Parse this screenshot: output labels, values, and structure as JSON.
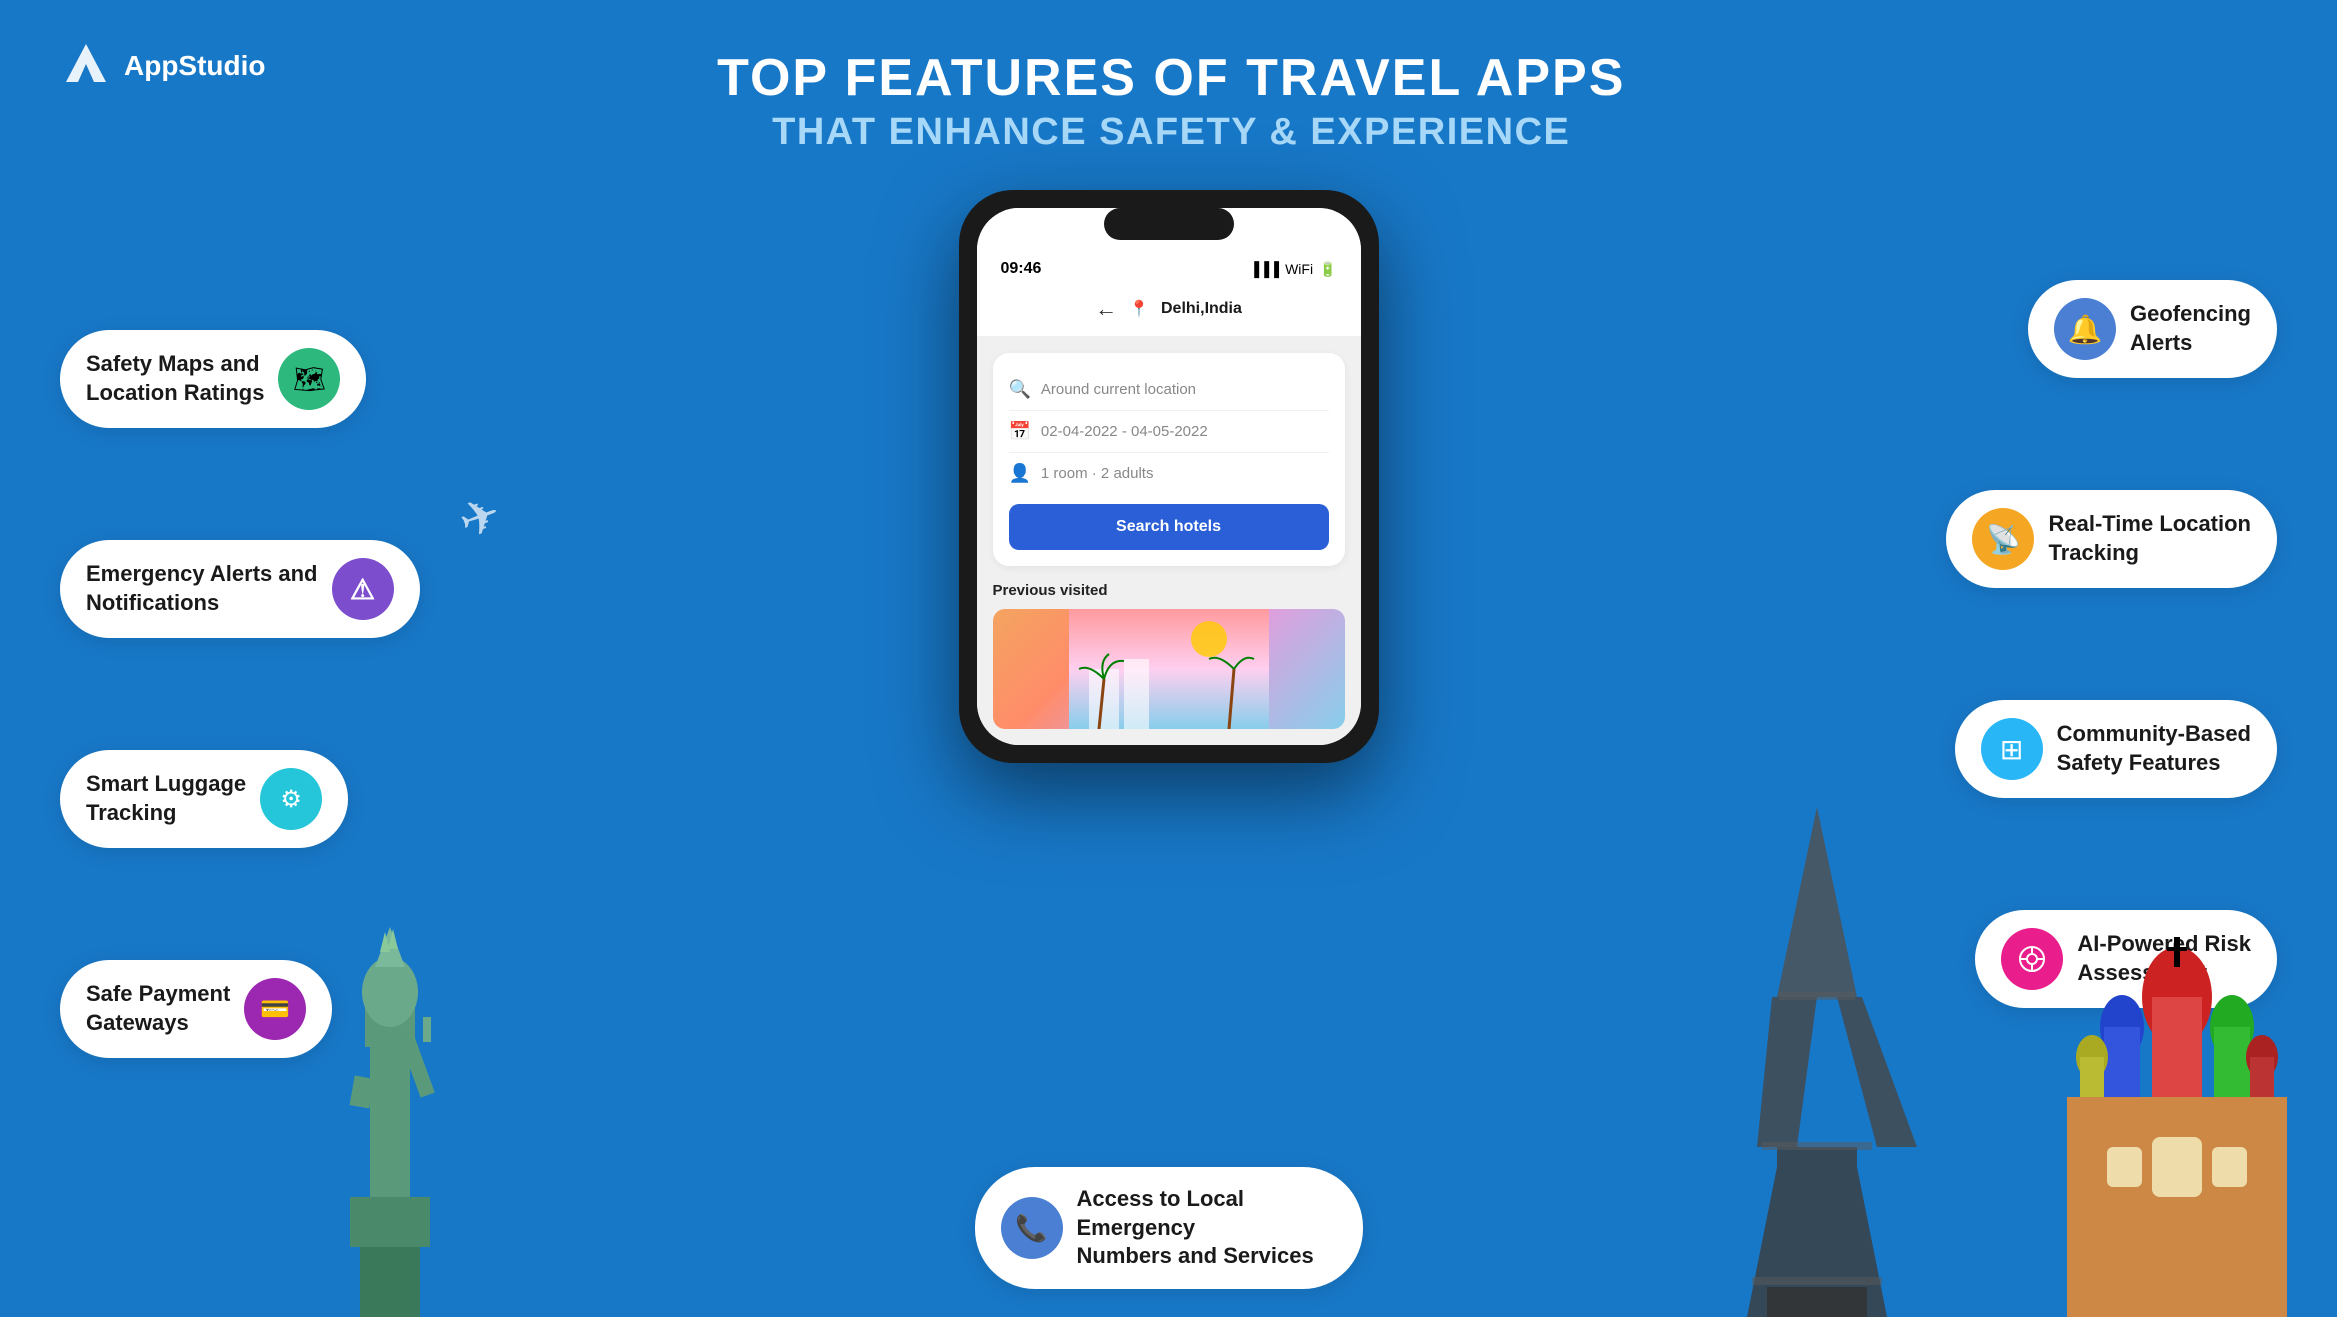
{
  "brand": {
    "logo_text": "AppStudio"
  },
  "header": {
    "title_main": "TOP FEATURES OF TRAVEL APPS",
    "title_sub": "THAT ENHANCE SAFETY & EXPERIENCE"
  },
  "phone": {
    "status_time": "09:46",
    "location": "Delhi,India",
    "around_label": "Around current location",
    "dates": "02-04-2022 - 04-05-2022",
    "guests": "1 room · 2 adults",
    "search_btn": "Search hotels",
    "prev_visited": "Previous visited"
  },
  "left_pills": [
    {
      "id": "safety-maps",
      "label": "Safety Maps and\nLocation Ratings",
      "icon": "🗺",
      "icon_color": "green"
    },
    {
      "id": "emergency-alerts",
      "label": "Emergency Alerts and\nNotifications",
      "icon": "⚠",
      "icon_color": "purple"
    },
    {
      "id": "smart-luggage",
      "label": "Smart Luggage\nTracking",
      "icon": "⚙",
      "icon_color": "teal"
    },
    {
      "id": "safe-payment",
      "label": "Safe Payment\nGateways",
      "icon": "💳",
      "icon_color": "violet"
    }
  ],
  "right_pills": [
    {
      "id": "geofencing",
      "label": "Geofencing\nAlerts",
      "icon": "🔔",
      "icon_color": "blue"
    },
    {
      "id": "realtime-location",
      "label": "Real-Time Location\nTracking",
      "icon": "📡",
      "icon_color": "orange"
    },
    {
      "id": "community",
      "label": "Community-Based\nSafety Features",
      "icon": "⊞",
      "icon_color": "cyan"
    },
    {
      "id": "ai-risk",
      "label": "AI-Powered Risk\nAssessment",
      "icon": "⚙",
      "icon_color": "pink"
    }
  ],
  "bottom_pill": {
    "id": "emergency-numbers",
    "label": "Access to Local Emergency\nNumbers and Services",
    "icon": "📞",
    "icon_color": "blue-em"
  }
}
